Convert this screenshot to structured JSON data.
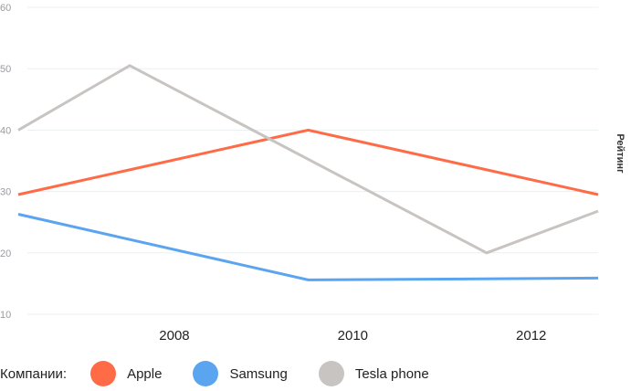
{
  "chart_data": {
    "type": "line",
    "ylabel": "Рейтинг",
    "xlabel": "",
    "ylim": [
      10,
      60
    ],
    "y_ticks": [
      10,
      20,
      30,
      40,
      50,
      60
    ],
    "x_ticks": [
      "2008",
      "2010",
      "2012"
    ],
    "xlim": [
      2006.25,
      2012.75
    ],
    "series": [
      {
        "name": "Apple",
        "color": "#ff6b47",
        "x": [
          2006.25,
          2009.5,
          2012.75
        ],
        "values": [
          29.5,
          40,
          29.5
        ]
      },
      {
        "name": "Samsung",
        "color": "#5aa4f0",
        "x": [
          2006.25,
          2009.5,
          2012.75
        ],
        "values": [
          26.3,
          15.6,
          15.9
        ]
      },
      {
        "name": "Tesla phone",
        "color": "#c8c4c2",
        "x": [
          2006.25,
          2007.5,
          2011.5,
          2012.75
        ],
        "values": [
          40,
          50.5,
          20,
          26.8
        ]
      }
    ],
    "grid": true
  },
  "legend": {
    "title": "Компании:"
  }
}
